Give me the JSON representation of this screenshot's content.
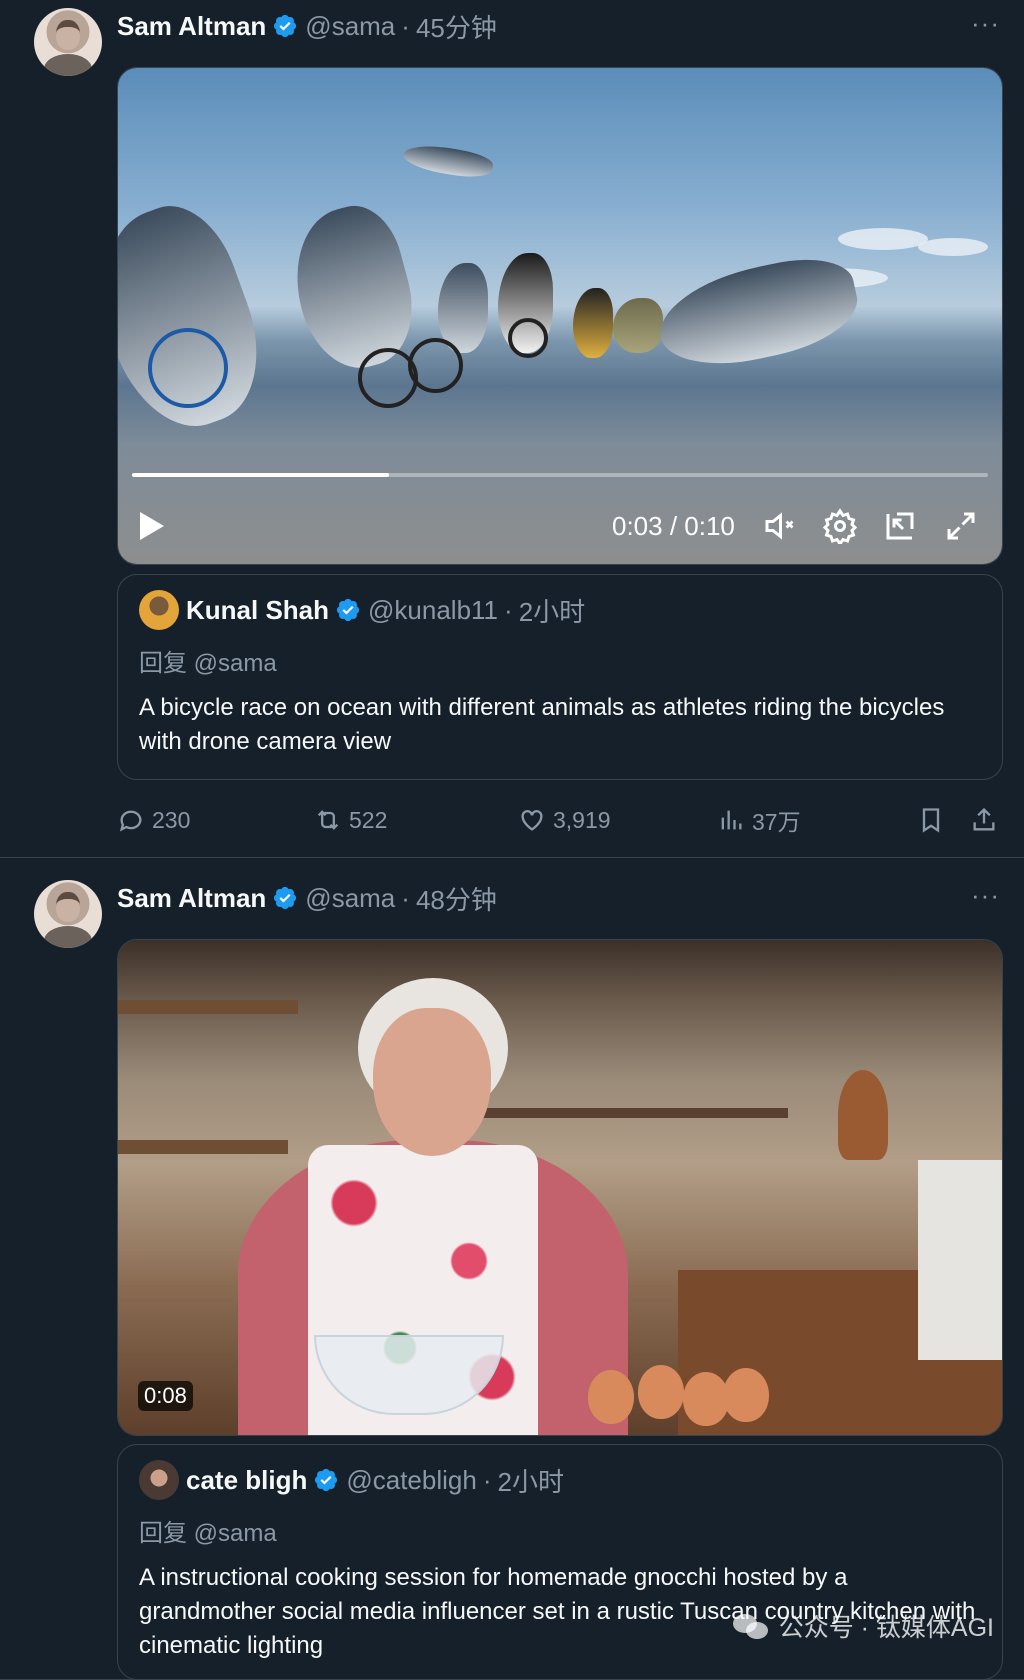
{
  "posts": [
    {
      "author": "Sam Altman",
      "handle": "@sama",
      "separator": "·",
      "time": "45分钟",
      "more": "···",
      "media": {
        "type": "video",
        "current_time": "0:03",
        "duration": "0:10",
        "time_display": "0:03 / 0:10",
        "progress_fraction": 0.3
      },
      "quote": {
        "author": "Kunal Shah",
        "handle": "@kunalb11",
        "separator": "·",
        "time": "2小时",
        "reply_to": "回复 @sama",
        "text": "A bicycle race on ocean with different animals as athletes riding the bicycles with drone camera view"
      },
      "actions": {
        "replies": "230",
        "reposts": "522",
        "likes": "3,919",
        "views": "37万"
      }
    },
    {
      "author": "Sam Altman",
      "handle": "@sama",
      "separator": "·",
      "time": "48分钟",
      "more": "···",
      "media": {
        "type": "video",
        "duration_badge": "0:08"
      },
      "quote": {
        "author": "cate bligh",
        "handle": "@catebligh",
        "separator": "·",
        "time": "2小时",
        "reply_to": "回复 @sama",
        "text": "A instructional cooking session for homemade gnocchi hosted by a grandmother social media influencer set in a rustic Tuscan country kitchen with cinematic lighting"
      }
    }
  ],
  "watermark": {
    "text": "公众号 · 钛媒体AGI",
    "icon": "wechat-icon"
  },
  "colors": {
    "background": "#15202b",
    "border": "#38444d",
    "secondary_text": "#8b98a5",
    "verified": "#1d9bf0"
  }
}
